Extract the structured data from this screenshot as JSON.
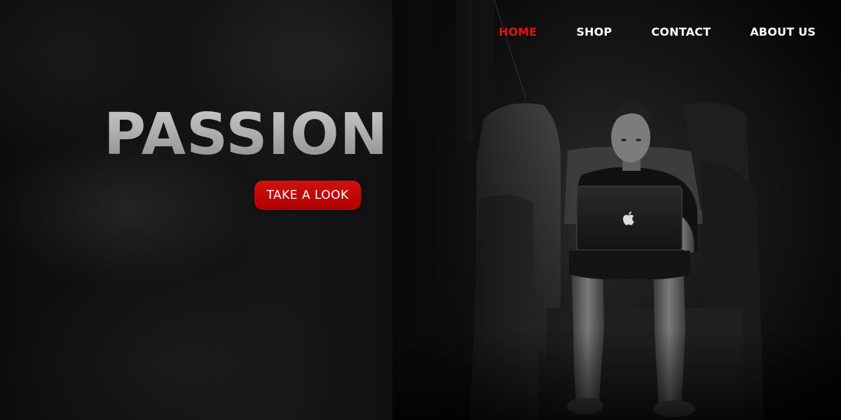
{
  "nav": {
    "items": [
      {
        "label": "HOME",
        "active": true
      },
      {
        "label": "SHOP",
        "active": false
      },
      {
        "label": "CONTACT",
        "active": false
      },
      {
        "label": "ABOUT US",
        "active": false
      }
    ]
  },
  "hero": {
    "headline": "PASSION",
    "cta_label": "TAKE A LOOK",
    "image_subject": "man in black t-shirt sitting on a couch working on an Apple laptop"
  },
  "colors": {
    "accent": "#e21010",
    "cta_background": "#c00000",
    "headline": "#b3b3b3",
    "background": "#0d0d0d",
    "nav_text": "#ffffff"
  },
  "icons": {
    "laptop_logo": "apple-logo-icon"
  }
}
